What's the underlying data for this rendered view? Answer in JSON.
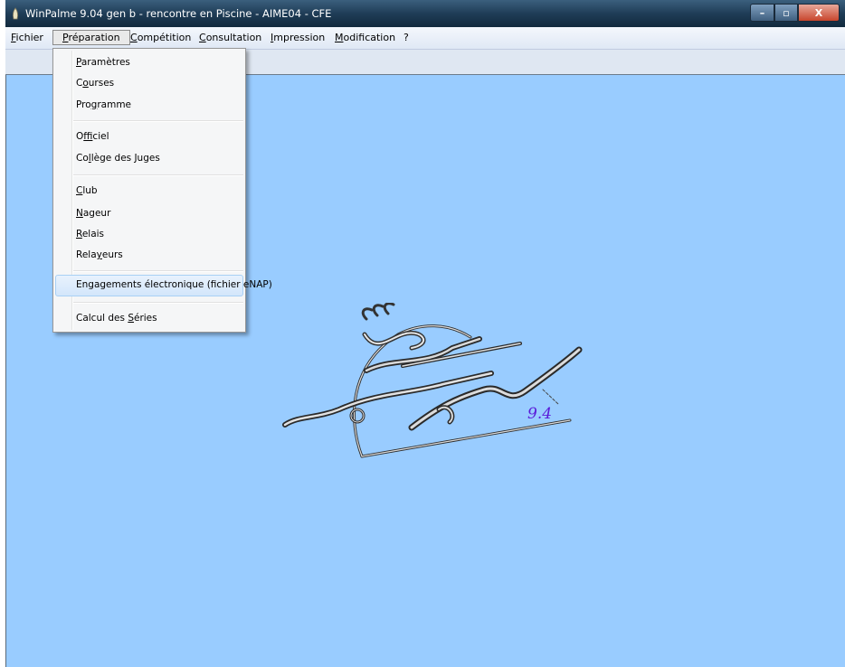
{
  "window": {
    "title": "WinPalme 9.04 gen b  -  rencontre en Piscine  -  AIME04  -  CFE",
    "btn_min": "–",
    "btn_max": "▫",
    "btn_close": "X"
  },
  "menubar": {
    "fichier": {
      "ul": "F",
      "rest": "ichier"
    },
    "preparation": {
      "ul": "P",
      "rest": "réparation"
    },
    "competition": {
      "ul": "C",
      "rest": "ompétition"
    },
    "consultation": {
      "ul": "C",
      "rest": "onsultation"
    },
    "impression": {
      "ul": "I",
      "rest": "mpression"
    },
    "modification": {
      "ul": "M",
      "rest": "odification"
    },
    "help": "?"
  },
  "dropdown": {
    "parametres": {
      "ul": "P",
      "rest": "aramètres"
    },
    "courses": {
      "pre": "C",
      "ul": "o",
      "rest": "urses"
    },
    "programme": {
      "pre": "Pro",
      "ul": "g",
      "rest": "ramme"
    },
    "officiel": {
      "pre": "O",
      "ul": "f",
      "rest": "ficiel"
    },
    "college": {
      "pre": "Co",
      "ul": "l",
      "rest": "lège des Juges"
    },
    "club": {
      "ul": "C",
      "rest": "lub"
    },
    "nageur": {
      "ul": "N",
      "rest": "ageur"
    },
    "relais": {
      "ul": "R",
      "rest": "elais"
    },
    "relayeurs": {
      "pre": "Rela",
      "ul": "y",
      "rest": "eurs"
    },
    "engagements": "Engagements électronique (fichier eNAP)",
    "calcul": {
      "pre": "Calcul des ",
      "ul": "S",
      "rest": "éries"
    }
  },
  "logo": {
    "version": "9.4"
  }
}
